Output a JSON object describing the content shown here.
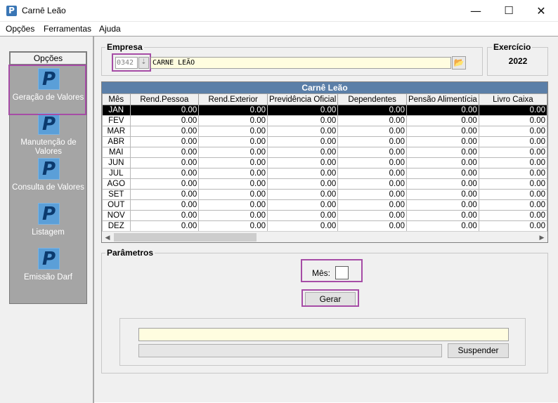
{
  "window": {
    "title": "Carnê Leão",
    "icon": "P",
    "controls": {
      "minimize": "—",
      "maximize": "☐",
      "close": "✕"
    }
  },
  "menu": [
    "Opções",
    "Ferramentas",
    "Ajuda"
  ],
  "sidebar": {
    "header": "Opções",
    "icon_glyph": "P",
    "items": [
      {
        "label": "Geração de Valores",
        "selected": true
      },
      {
        "label": "Manutenção de Valores",
        "selected": false
      },
      {
        "label": "Consulta de Valores",
        "selected": false
      },
      {
        "label": "Listagem",
        "selected": false
      },
      {
        "label": "Emissão Darf",
        "selected": false
      }
    ]
  },
  "empresa": {
    "label": "Empresa",
    "code": "0342",
    "name": "CARNE LEÃO"
  },
  "exercicio": {
    "label": "Exercício",
    "value": "2022"
  },
  "grid": {
    "title": "Carnê Leão",
    "columns": [
      "Mês",
      "Rend.Pessoa",
      "Rend.Exterior",
      "Previdência Oficial",
      "Dependentes",
      "Pensão Alimentícia",
      "Livro Caixa"
    ],
    "rows": [
      [
        "JAN",
        "0.00",
        "0.00",
        "0.00",
        "0.00",
        "0.00",
        "0.00"
      ],
      [
        "FEV",
        "0.00",
        "0.00",
        "0.00",
        "0.00",
        "0.00",
        "0.00"
      ],
      [
        "MAR",
        "0.00",
        "0.00",
        "0.00",
        "0.00",
        "0.00",
        "0.00"
      ],
      [
        "ABR",
        "0.00",
        "0.00",
        "0.00",
        "0.00",
        "0.00",
        "0.00"
      ],
      [
        "MAI",
        "0.00",
        "0.00",
        "0.00",
        "0.00",
        "0.00",
        "0.00"
      ],
      [
        "JUN",
        "0.00",
        "0.00",
        "0.00",
        "0.00",
        "0.00",
        "0.00"
      ],
      [
        "JUL",
        "0.00",
        "0.00",
        "0.00",
        "0.00",
        "0.00",
        "0.00"
      ],
      [
        "AGO",
        "0.00",
        "0.00",
        "0.00",
        "0.00",
        "0.00",
        "0.00"
      ],
      [
        "SET",
        "0.00",
        "0.00",
        "0.00",
        "0.00",
        "0.00",
        "0.00"
      ],
      [
        "OUT",
        "0.00",
        "0.00",
        "0.00",
        "0.00",
        "0.00",
        "0.00"
      ],
      [
        "NOV",
        "0.00",
        "0.00",
        "0.00",
        "0.00",
        "0.00",
        "0.00"
      ],
      [
        "DEZ",
        "0.00",
        "0.00",
        "0.00",
        "0.00",
        "0.00",
        "0.00"
      ]
    ],
    "selected_row": 0
  },
  "parametros": {
    "label": "Parâmetros",
    "mes_label": "Mês:",
    "mes_value": "",
    "gerar_label": "Gerar",
    "suspender_label": "Suspender",
    "status_text": ""
  },
  "colors": {
    "highlight": "#a64ca6",
    "grid_header": "#5b7fa8",
    "sidebar_bg": "#a5a5a5",
    "input_yellow": "#fffde0"
  }
}
